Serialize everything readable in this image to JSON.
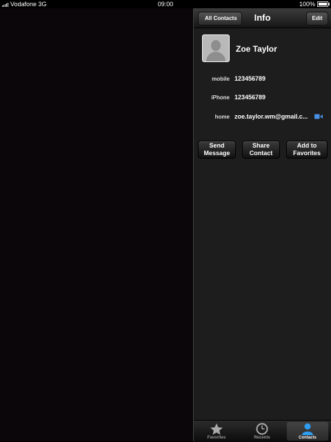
{
  "status_bar": {
    "carrier": "Vodafone 3G",
    "time": "09:00",
    "battery": "100%"
  },
  "navbar": {
    "back_label": "All Contacts",
    "title": "Info",
    "edit_label": "Edit"
  },
  "contact": {
    "name": "Zoe Taylor",
    "fields": [
      {
        "label": "mobile",
        "value": "123456789"
      },
      {
        "label": "iPhone",
        "value": "123456789"
      },
      {
        "label": "home",
        "value": "zoe.taylor.wm@gmail.c..."
      }
    ]
  },
  "actions": [
    {
      "label": "Send\nMessage"
    },
    {
      "label": "Share\nContact"
    },
    {
      "label": "Add to\nFavorites"
    }
  ],
  "tabbar": {
    "tabs": [
      {
        "label": "Favorites",
        "icon": "star-icon"
      },
      {
        "label": "Recents",
        "icon": "clock-icon"
      },
      {
        "label": "Contacts",
        "icon": "person-icon",
        "active": true
      }
    ]
  },
  "colors": {
    "facetime_blue": "#4a90e2",
    "active_tab_blue": "#2e9cf0"
  }
}
